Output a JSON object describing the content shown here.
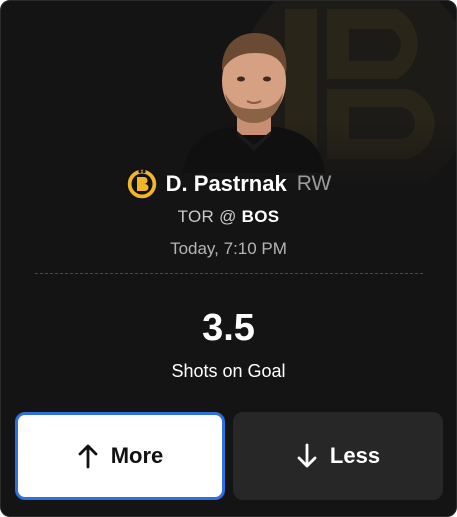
{
  "player": {
    "name": "D. Pastrnak",
    "position": "RW",
    "team_badge": "bruins-logo-icon",
    "headshot": "player-headshot"
  },
  "game": {
    "away_team": "TOR",
    "separator": "@",
    "home_team": "BOS",
    "time": "Today, 7:10 PM"
  },
  "projection": {
    "line": "3.5",
    "stat": "Shots on Goal"
  },
  "actions": {
    "more_label": "More",
    "less_label": "Less",
    "selected": "more"
  },
  "colors": {
    "card_bg": "#141414",
    "selected_border": "#2f6fde",
    "bruins_gold": "#f2b52a"
  }
}
